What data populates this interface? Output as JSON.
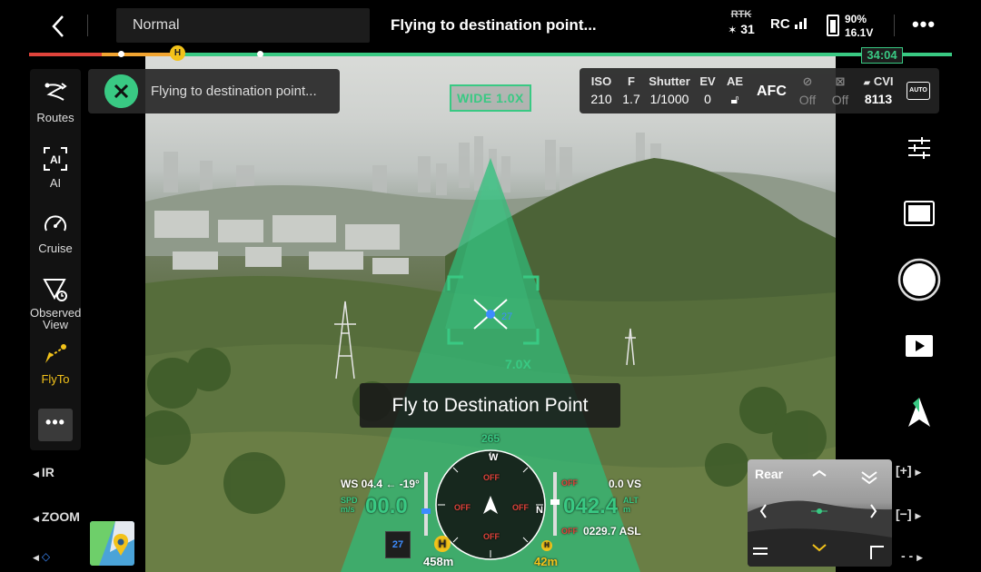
{
  "topbar": {
    "mode": "Normal",
    "status_title": "Flying to destination point...",
    "rtk_label": "RTK",
    "rtk_value": "31",
    "rc_label": "RC",
    "battery_pct": "90%",
    "battery_voltage": "16.1V",
    "more_label": "•••"
  },
  "progress": {
    "fraction_complete": 0.1,
    "time_remaining": "34:04",
    "home_marker": "H"
  },
  "left_toolbar": {
    "items": [
      {
        "label": "Routes",
        "icon": "routes-icon"
      },
      {
        "label": "AI",
        "icon": "ai-icon"
      },
      {
        "label": "Cruise",
        "icon": "cruise-icon"
      },
      {
        "label": "Observed View",
        "icon": "observed-view-icon"
      },
      {
        "label": "FlyTo",
        "icon": "flyto-icon",
        "active": true
      }
    ],
    "more_label": "•••"
  },
  "side_labels": {
    "ir": "IR",
    "zoom": "ZOOM"
  },
  "banner": {
    "text": "Flying to destination point..."
  },
  "lens": {
    "tag": "WIDE 1.0X",
    "target_zoom": "7.0X"
  },
  "camera_params": {
    "iso_label": "ISO",
    "iso_value": "210",
    "f_label": "F",
    "f_value": "1.7",
    "shutter_label": "Shutter",
    "shutter_value": "1/1000",
    "ev_label": "EV",
    "ev_value": "0",
    "ae_label": "AE",
    "afc_label": "AFC",
    "opt1_value": "Off",
    "opt2_value": "Off",
    "storage_label": "CVI",
    "storage_value": "8113",
    "mode_badge": "AUTO"
  },
  "flyto": {
    "label": "Fly to Destination Point"
  },
  "hud": {
    "heading": "265",
    "wind": "WS 04.4 ← -19°",
    "spd_label_1": "SPD",
    "spd_label_2": "m/s",
    "speed": "00.0",
    "vs": "0.0 VS",
    "alt": "042.4",
    "alt_label_1": "ALT",
    "alt_label_2": "m",
    "asl": "0229.7 ASL",
    "distance": "458m",
    "height": "42m",
    "signal_count": "27",
    "off_label": "OFF",
    "compass_w": "W",
    "compass_n": "N",
    "home_marker": "H"
  },
  "pip": {
    "title": "Rear"
  },
  "zoom_controls": {
    "plus": "[+]",
    "minus": "[−]"
  }
}
